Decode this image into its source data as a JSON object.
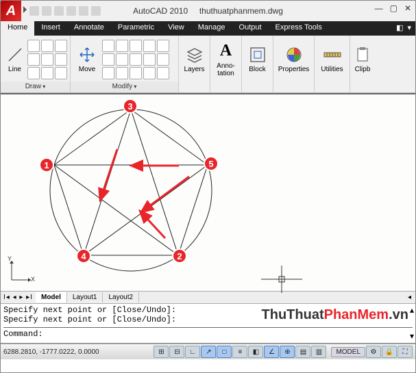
{
  "window": {
    "app_name": "AutoCAD 2010",
    "file_name": "thuthuatphanmem.dwg"
  },
  "tabs": {
    "home": "Home",
    "insert": "Insert",
    "annotate": "Annotate",
    "parametric": "Parametric",
    "view": "View",
    "manage": "Manage",
    "output": "Output",
    "express": "Express Tools"
  },
  "ribbon": {
    "draw": {
      "title": "Draw",
      "line": "Line"
    },
    "modify": {
      "title": "Modify",
      "move": "Move"
    },
    "layers": {
      "title": "Layers"
    },
    "annotation": {
      "title": "Anno-\ntation"
    },
    "block": {
      "title": "Block"
    },
    "properties": {
      "title": "Properties"
    },
    "utilities": {
      "title": "Utilities"
    },
    "clipboard": {
      "title": "Clipb"
    }
  },
  "layout_tabs": {
    "nav": "I◂ ◂ ▸ ▸I",
    "model": "Model",
    "layout1": "Layout1",
    "layout2": "Layout2"
  },
  "command": {
    "line1": "Specify next point or [Close/Undo]:",
    "line2": "Specify next point or [Close/Undo]:",
    "prompt_label": "Command:",
    "prompt_value": ""
  },
  "status": {
    "coords": "6288.2810, -1777.0222, 0.0000",
    "model": "MODEL"
  },
  "drawing": {
    "point_labels": {
      "p1": "1",
      "p2": "2",
      "p3": "3",
      "p4": "4",
      "p5": "5"
    }
  },
  "watermark": {
    "part1": "ThuThuat",
    "part2": "PhanMem",
    "part3": ".vn"
  },
  "ucs": {
    "x": "X",
    "y": "Y"
  }
}
